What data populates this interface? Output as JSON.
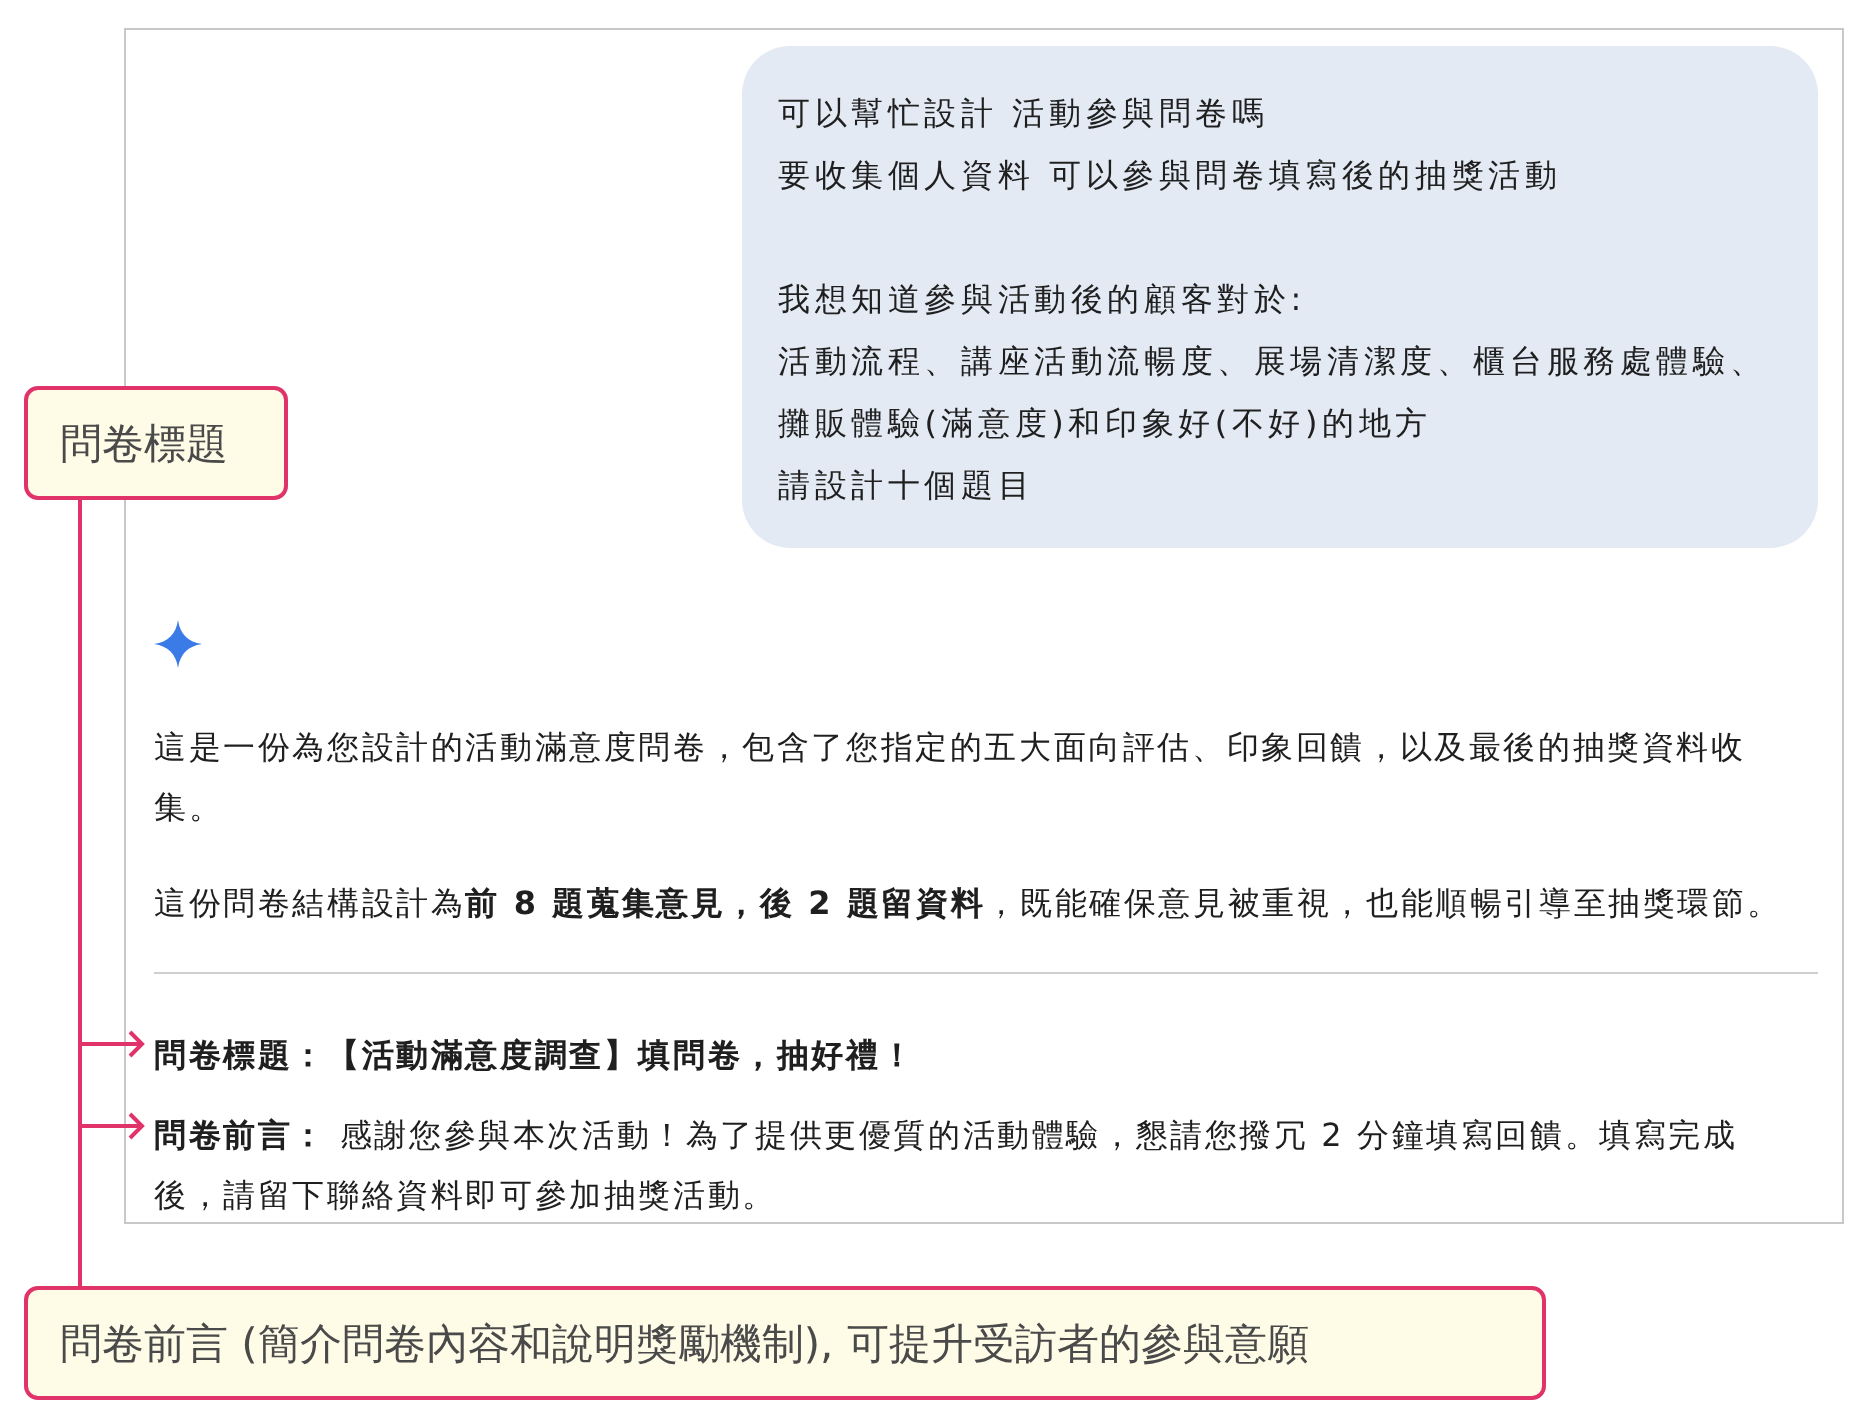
{
  "user_message": {
    "groups": [
      [
        "可以幫忙設計 活動參與問卷嗎",
        "要收集個人資料 可以參與問卷填寫後的抽獎活動"
      ],
      [
        "我想知道參與活動後的顧客對於:",
        "活動流程、講座活動流暢度、展場清潔度、櫃台服務處體驗、攤販體驗(滿意度)和印象好(不好)的地方",
        "請設計十個題目"
      ]
    ]
  },
  "response": {
    "paragraphs": [
      "這是一份為您設計的活動滿意度問卷，包含了您指定的五大面向評估、印象回饋，以及最後的抽獎資料收集。",
      "這份問卷結構設計為**前 8 題蒐集意見，後 2 題留資料**，既能確保意見被重視，也能順暢引導至抽獎環節。"
    ],
    "survey_title": "問卷標題：【活動滿意度調查】填問卷，抽好禮！",
    "survey_intro": "**問卷前言：** 感謝您參與本次活動！為了提供更優質的活動體驗，懇請您撥冗 2 分鐘填寫回饋。填寫完成後，請留下聯絡資料即可參加抽獎活動。"
  },
  "annotations": [
    {
      "kind": "title",
      "text": "問卷標題"
    },
    {
      "kind": "intro",
      "text": "問卷前言 (簡介問卷內容和說明獎勵機制), 可提升受訪者的參與意願"
    }
  ]
}
